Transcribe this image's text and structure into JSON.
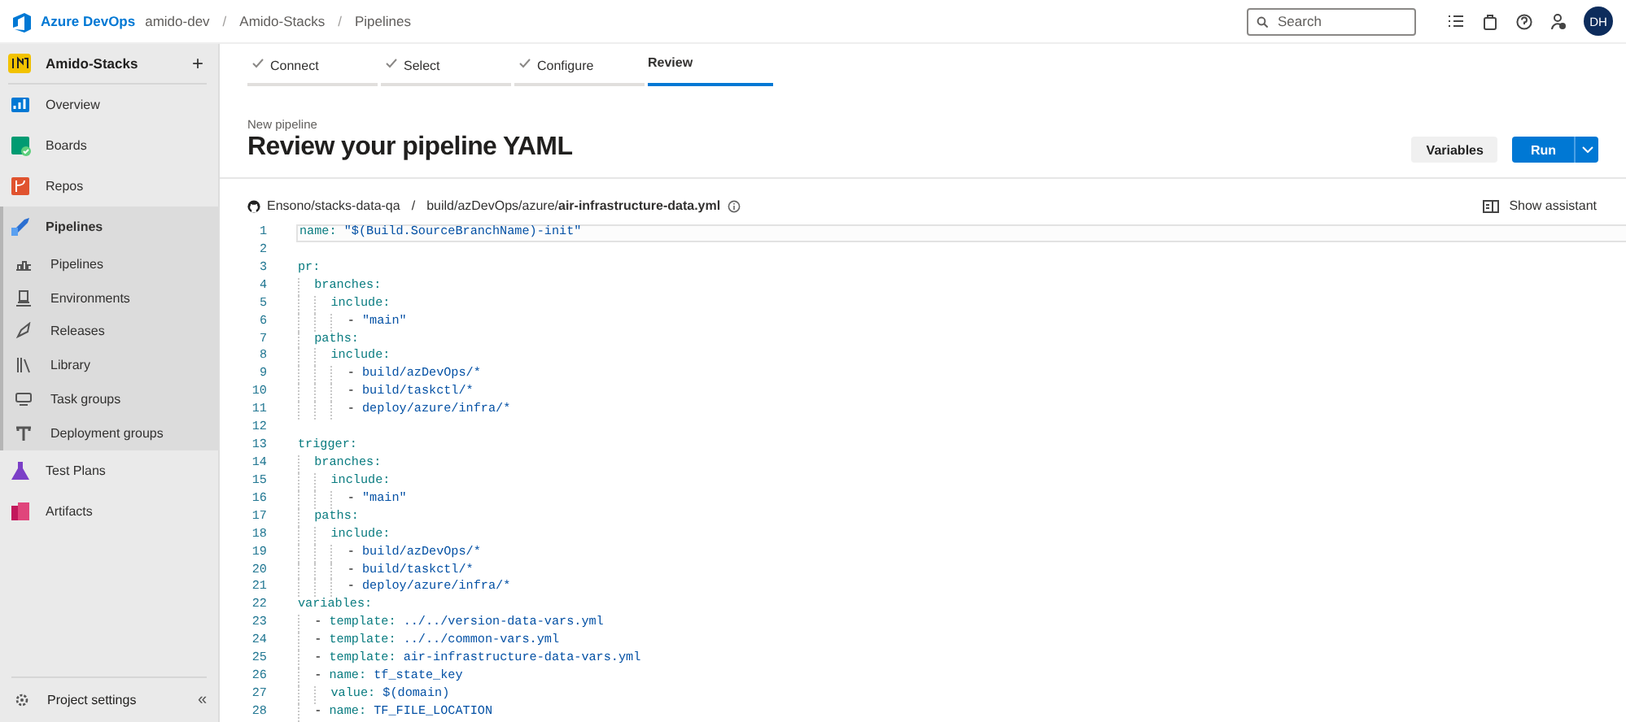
{
  "topbar": {
    "product": "Azure DevOps",
    "breadcrumbs": [
      {
        "label": "amido-dev",
        "separator": "/"
      },
      {
        "label": "Amido-Stacks",
        "separator": "/"
      },
      {
        "label": "Pipelines"
      }
    ],
    "search": {
      "placeholder": "Search"
    },
    "avatar": "DH"
  },
  "sidebar": {
    "project": "Amido-Stacks",
    "add": "+",
    "items": [
      {
        "label": "Overview",
        "kind": "overview",
        "selected": false
      },
      {
        "label": "Boards",
        "kind": "boards",
        "selected": false
      },
      {
        "label": "Repos",
        "kind": "repos",
        "selected": false
      },
      {
        "label": "Pipelines",
        "kind": "pipelines",
        "selected": true,
        "expanded": true,
        "children": [
          {
            "label": "Pipelines",
            "kind": "pipelines-sub",
            "selected": false
          },
          {
            "label": "Environments",
            "kind": "environments",
            "selected": false
          },
          {
            "label": "Releases",
            "kind": "releases",
            "selected": false
          },
          {
            "label": "Library",
            "kind": "library",
            "selected": false
          },
          {
            "label": "Task groups",
            "kind": "taskgroups",
            "selected": false
          },
          {
            "label": "Deployment groups",
            "kind": "deployment",
            "selected": false
          }
        ]
      },
      {
        "label": "Test Plans",
        "kind": "testplans",
        "selected": false
      },
      {
        "label": "Artifacts",
        "kind": "artifacts",
        "selected": false
      }
    ],
    "footer": {
      "label": "Project settings",
      "collapse": "«"
    }
  },
  "wizard": {
    "steps": [
      {
        "label": "Connect",
        "done": true,
        "selected": false
      },
      {
        "label": "Select",
        "done": true,
        "selected": false
      },
      {
        "label": "Configure",
        "done": true,
        "selected": false
      },
      {
        "label": "Review",
        "done": false,
        "selected": true
      }
    ]
  },
  "header": {
    "subtitle": "New pipeline",
    "title": "Review your pipeline YAML",
    "buttons": [
      {
        "label": "Variables",
        "kind": "secondary"
      },
      {
        "label": "Run",
        "kind": "primary"
      }
    ]
  },
  "file": {
    "repo": "Ensono/stacks-data-qa",
    "separator": "/",
    "folder": "build/azDevOps/azure/",
    "name": "air-infrastructure-data.yml",
    "assistant": "Show assistant"
  },
  "code": {
    "lines": [
      {
        "number": "1",
        "code": "name: \"$(Build.SourceBranchName)-init\"",
        "current": true
      },
      {
        "number": "2",
        "current": false
      },
      {
        "number": "3",
        "code": "pr:",
        "current": false
      },
      {
        "number": "4",
        "code": "  branches:",
        "current": false
      },
      {
        "number": "5",
        "code": "    include:",
        "current": false
      },
      {
        "number": "6",
        "code": "      - \"main\"",
        "current": false
      },
      {
        "number": "7",
        "code": "  paths:",
        "current": false
      },
      {
        "number": "8",
        "code": "    include:",
        "current": false
      },
      {
        "number": "9",
        "code": "      - build/azDevOps/*",
        "current": false
      },
      {
        "number": "10",
        "code": "      - build/taskctl/*",
        "current": false
      },
      {
        "number": "11",
        "code": "      - deploy/azure/infra/*",
        "current": false
      },
      {
        "number": "12",
        "current": false
      },
      {
        "number": "13",
        "code": "trigger:",
        "current": false
      },
      {
        "number": "14",
        "code": "  branches:",
        "current": false
      },
      {
        "number": "15",
        "code": "    include:",
        "current": false
      },
      {
        "number": "16",
        "code": "      - \"main\"",
        "current": false
      },
      {
        "number": "17",
        "code": "  paths:",
        "current": false
      },
      {
        "number": "18",
        "code": "    include:",
        "current": false
      },
      {
        "number": "19",
        "code": "      - build/azDevOps/*",
        "current": false
      },
      {
        "number": "20",
        "code": "      - build/taskctl/*",
        "current": false
      },
      {
        "number": "21",
        "code": "      - deploy/azure/infra/*",
        "current": false
      },
      {
        "number": "22",
        "code": "variables:",
        "current": false
      },
      {
        "number": "23",
        "code": "  - template: ../../version-data-vars.yml",
        "current": false
      },
      {
        "number": "24",
        "code": "  - template: ../../common-vars.yml",
        "current": false
      },
      {
        "number": "25",
        "code": "  - template: air-infrastructure-data-vars.yml",
        "current": false
      },
      {
        "number": "26",
        "code": "  - name: tf_state_key",
        "current": false
      },
      {
        "number": "27",
        "code": "    value: $(domain)",
        "current": false
      },
      {
        "number": "28",
        "code": "  - name: TF_FILE_LOCATION",
        "current": false
      }
    ]
  }
}
